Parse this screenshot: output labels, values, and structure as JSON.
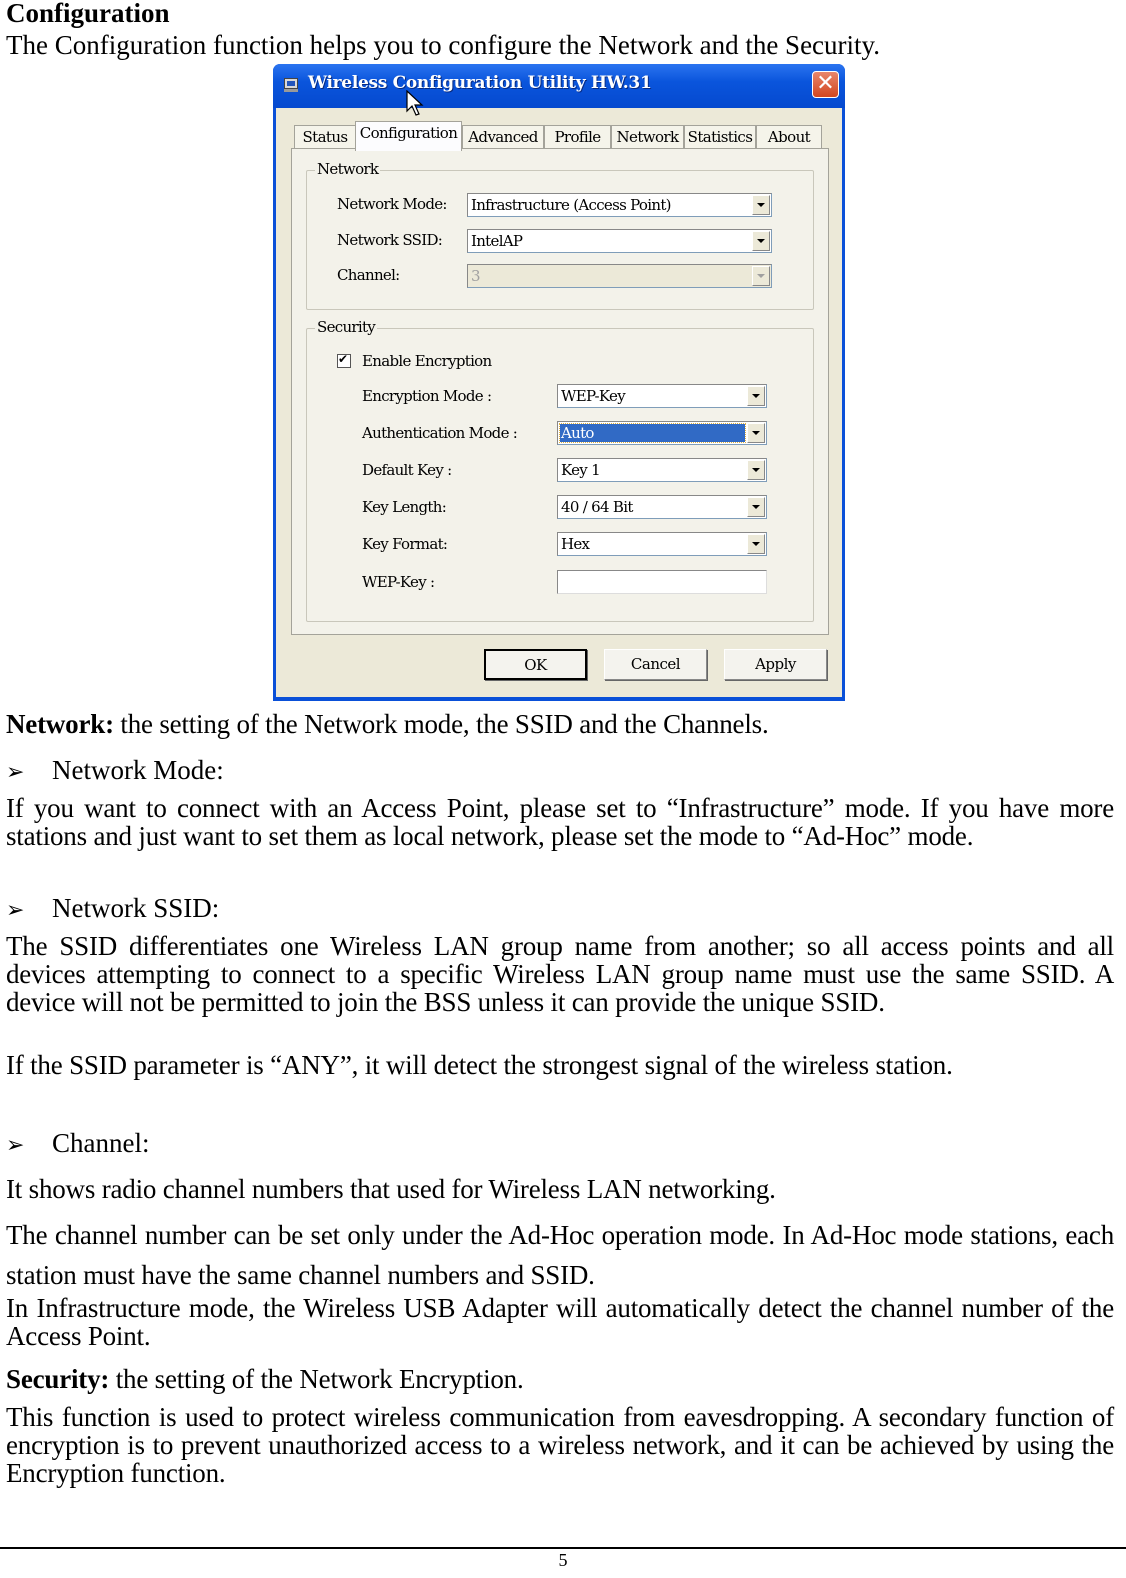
{
  "doc": {
    "heading": "Configuration",
    "intro": "The Configuration function helps you to configure the Network and the Security.",
    "network_section": {
      "label": "Network:",
      "text": " the setting of the Network mode, the SSID and the Channels."
    },
    "bullets": {
      "network_mode": "Network Mode:",
      "network_ssid": "Network SSID:",
      "channel": "Channel:"
    },
    "paragraphs": {
      "network_mode_desc": "If you want to connect with an Access Point, please set to “Infrastructure” mode. If you have more stations and just want to set them as local network, please set the mode to “Ad-Hoc” mode.",
      "ssid_desc": "The SSID differentiates one Wireless LAN group name from another; so all access points and all devices attempting to connect to a specific Wireless LAN group name must use the same SSID. A device will not be permitted to join the BSS unless it can provide the unique SSID.",
      "ssid_any": "If the SSID parameter is “ANY”, it will detect the strongest signal of the wireless station.",
      "channel_desc1": "It shows radio channel numbers that used for Wireless LAN networking.",
      "channel_desc2": "The channel number can be set only under the Ad-Hoc operation mode. In Ad-Hoc mode stations, each station must have the same channel numbers and SSID.",
      "channel_desc3": "In Infrastructure mode, the Wireless USB Adapter will automatically detect the channel number of the Access Point.",
      "security_desc": "This function is used to protect wireless communication from eavesdropping. A secondary function of encryption is to prevent unauthorized access to a wireless network, and it can be achieved by using the Encryption function."
    },
    "security_section": {
      "label": "Security:",
      "text": " the setting of the Network Encryption."
    },
    "page_number": "5"
  },
  "window": {
    "title": "Wireless Configuration Utility HW.31",
    "close_glyph": "✕",
    "tabs": [
      {
        "label": "Status",
        "active": false
      },
      {
        "label": "Configuration",
        "active": true
      },
      {
        "label": "Advanced",
        "active": false
      },
      {
        "label": "Profile",
        "active": false
      },
      {
        "label": "Network",
        "active": false
      },
      {
        "label": "Statistics",
        "active": false
      },
      {
        "label": "About",
        "active": false
      }
    ],
    "network_group": {
      "title": "Network",
      "network_mode_label": "Network Mode:",
      "network_mode_value": "Infrastructure (Access Point)",
      "ssid_label": "Network SSID:",
      "ssid_value": "IntelAP",
      "channel_label": "Channel:",
      "channel_value": "3"
    },
    "security_group": {
      "title": "Security",
      "enable_encryption_label": "Enable Encryption",
      "enable_encryption_checked": true,
      "encryption_mode_label": "Encryption Mode :",
      "encryption_mode_value": "WEP-Key",
      "auth_mode_label": "Authentication Mode :",
      "auth_mode_value": "Auto",
      "default_key_label": "Default Key :",
      "default_key_value": "Key 1",
      "key_length_label": "Key Length:",
      "key_length_value": "40 / 64 Bit",
      "key_format_label": "Key Format:",
      "key_format_value": "Hex",
      "wep_key_label": "WEP-Key :",
      "wep_key_value": ""
    },
    "buttons": {
      "ok": "OK",
      "cancel": "Cancel",
      "apply": "Apply"
    },
    "colors": {
      "titlebar": "#0a55dc",
      "dialog_bg": "#ece9d8",
      "selection": "#316ac5",
      "close": "#d2461f"
    }
  }
}
